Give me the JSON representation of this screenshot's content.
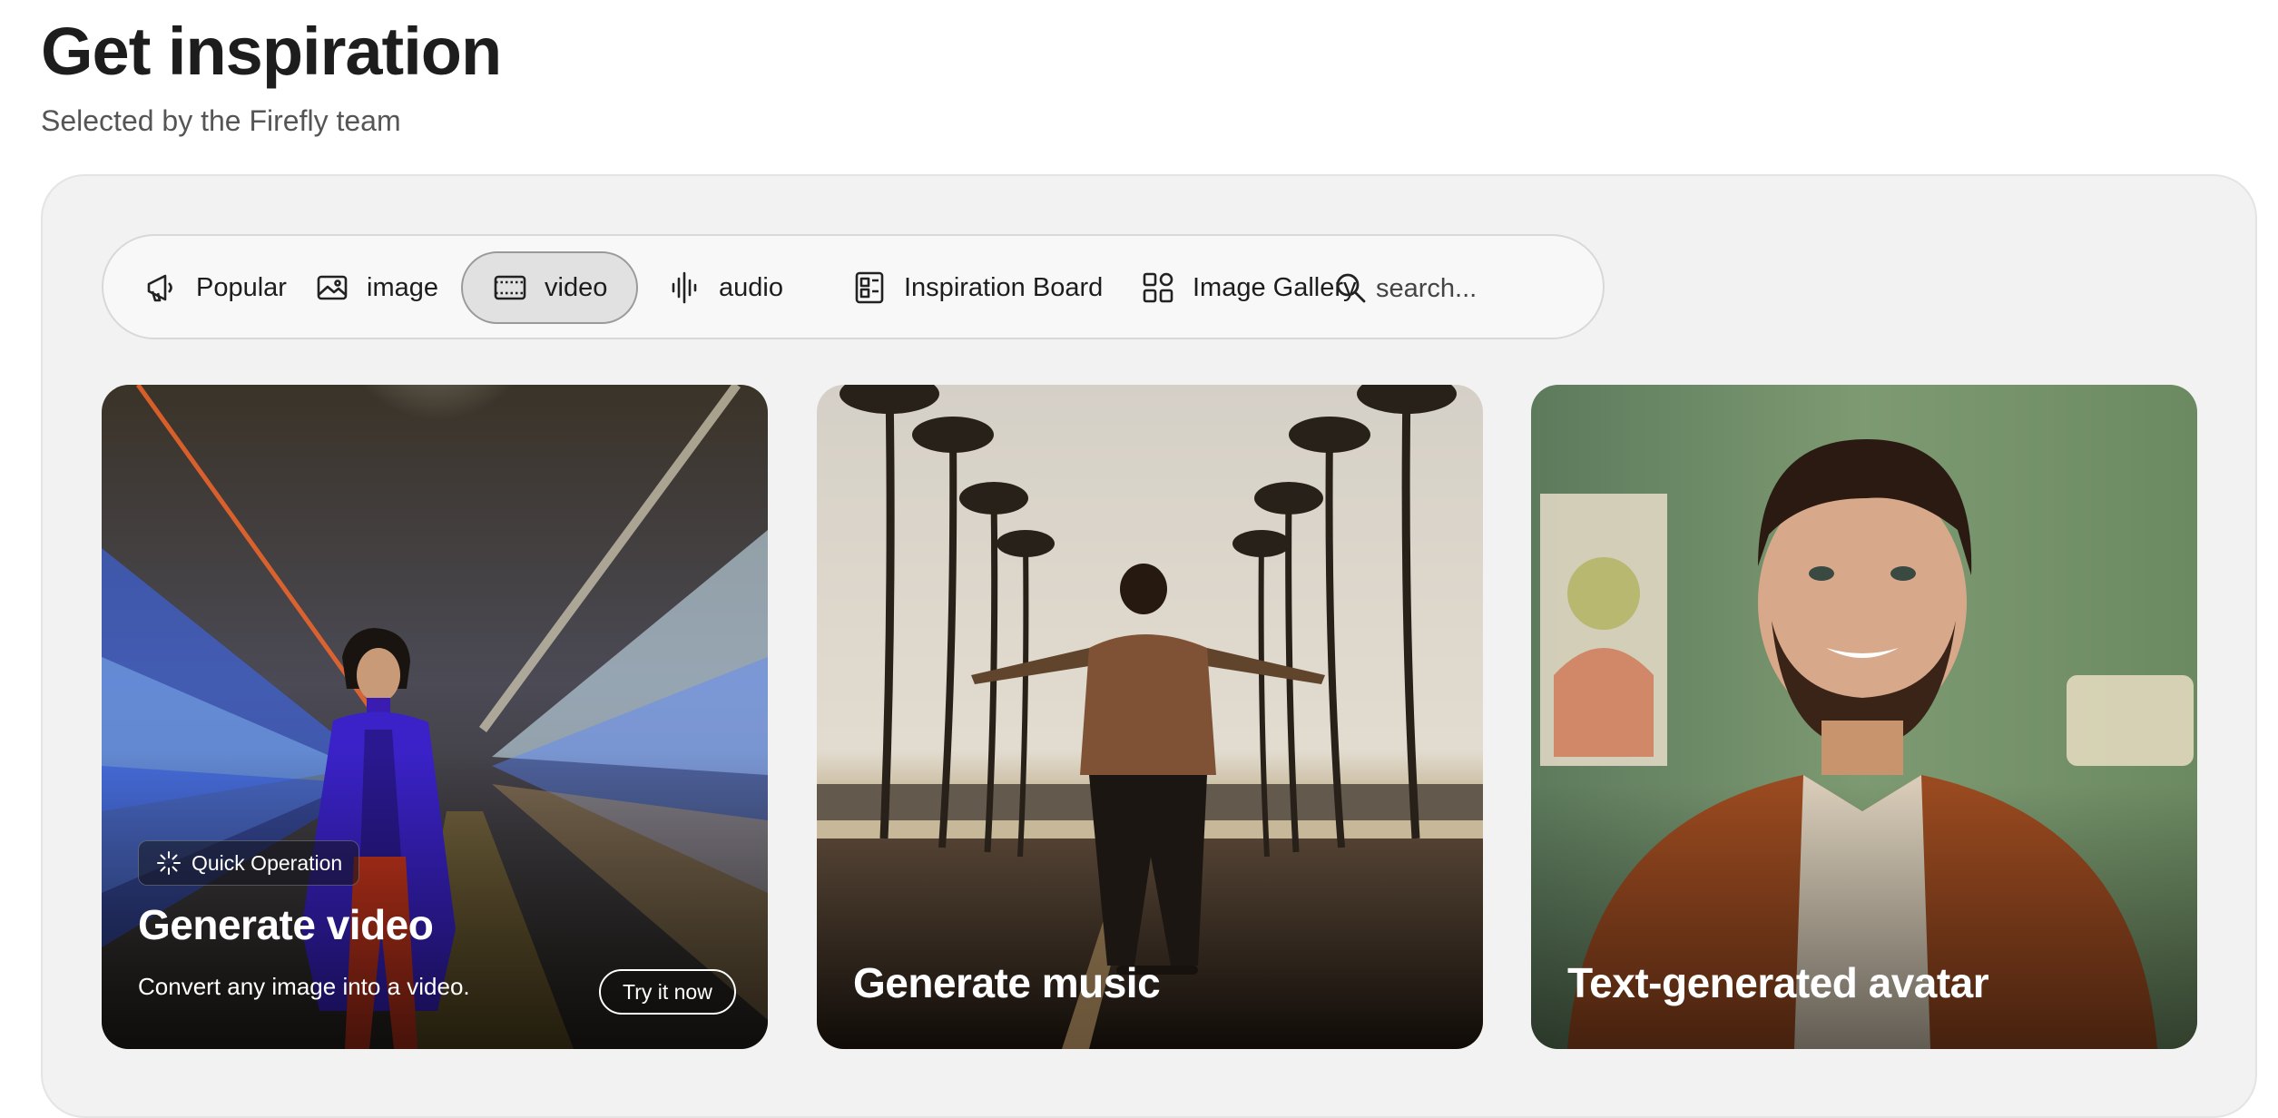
{
  "header": {
    "title": "Get inspiration",
    "subtitle": "Selected by the Firefly team"
  },
  "filters": [
    {
      "label": "Popular",
      "icon": "megaphone-icon"
    },
    {
      "label": "image",
      "icon": "image-icon"
    },
    {
      "label": "video",
      "icon": "film-icon",
      "active": true
    },
    {
      "label": "audio",
      "icon": "waveform-icon"
    },
    {
      "label": "Inspiration Board",
      "icon": "board-icon"
    },
    {
      "label": "Image Gallery",
      "icon": "grid-icon"
    }
  ],
  "search": {
    "placeholder": "search..."
  },
  "cards": [
    {
      "title": "Generate video",
      "badge": "Quick Operation",
      "description": "Convert any image into a video.",
      "button": "Try it now"
    },
    {
      "title": "Generate music"
    },
    {
      "title": "Text-generated avatar"
    }
  ],
  "colors": {
    "panel_bg": "#f2f2f2",
    "active_chip_bg": "#e1e1e1",
    "coat": "#3a22c8"
  }
}
